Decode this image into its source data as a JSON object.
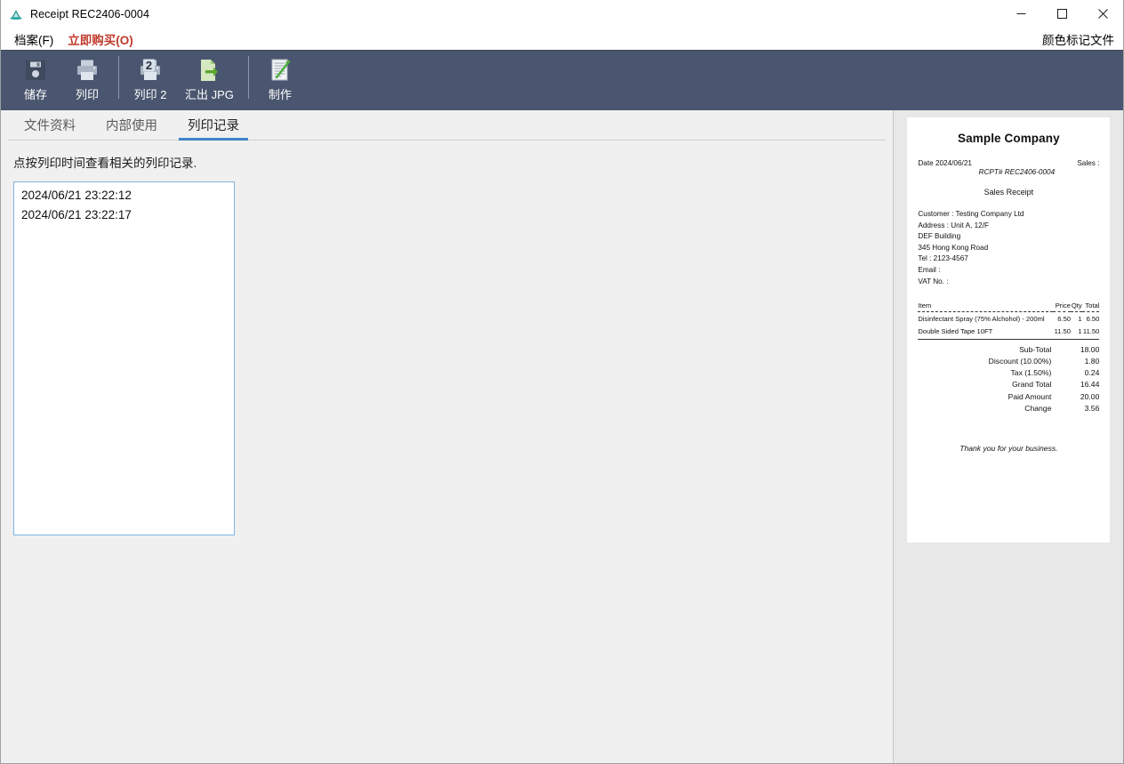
{
  "window": {
    "title": "Receipt REC2406-0004",
    "icon": "app-icon",
    "controls": {
      "minimize": "—",
      "maximize": "☐",
      "close": "✕"
    }
  },
  "menu": {
    "items": [
      {
        "label": "档案(F)",
        "name": "menu-file",
        "accent": false
      },
      {
        "label": "立即购买(O)",
        "name": "menu-buy-now",
        "accent": true
      }
    ],
    "right_label": "颜色标记文件"
  },
  "toolbar": {
    "buttons": [
      {
        "label": "储存",
        "icon": "save-icon",
        "name": "toolbar-save"
      },
      {
        "label": "列印",
        "icon": "print-icon",
        "name": "toolbar-print"
      },
      {
        "label": "列印 2",
        "icon": "print-2-icon",
        "name": "toolbar-print-2"
      },
      {
        "label": "汇出 JPG",
        "icon": "export-jpg-icon",
        "name": "toolbar-export-jpg"
      },
      {
        "label": "制作",
        "icon": "compose-icon",
        "name": "toolbar-compose"
      }
    ]
  },
  "tabs": [
    {
      "label": "文件资料",
      "name": "tab-document-info",
      "active": false
    },
    {
      "label": "内部使用",
      "name": "tab-internal-use",
      "active": false
    },
    {
      "label": "列印记录",
      "name": "tab-print-log",
      "active": true
    }
  ],
  "pane": {
    "hint": "点按列印时间查看相关的列印记录.",
    "print_log": [
      "2024/06/21 23:22:12",
      "2024/06/21 23:22:17"
    ]
  },
  "receipt": {
    "company": "Sample Company",
    "date_label": "Date 2024/06/21",
    "sales_label": "Sales :",
    "rcpt_no": "RCPT# REC2406-0004",
    "doc_title": "Sales Receipt",
    "customer_lines": [
      "Customer : Testing Company Ltd",
      "Address : Unit A, 12/F",
      "DEF Building",
      "345 Hong Kong Road",
      "Tel : 2123-4567",
      "Email :",
      "VAT No. :"
    ],
    "columns": [
      "Item",
      "Price",
      "Qty",
      "Total"
    ],
    "items": [
      {
        "item": "Disinfectant Spray (75% Alchohol) - 200ml",
        "price": "6.50",
        "qty": "1",
        "total": "6.50"
      },
      {
        "item": "Double Sided Tape 10FT",
        "price": "11.50",
        "qty": "1",
        "total": "11.50"
      }
    ],
    "totals": [
      {
        "label": "Sub-Total",
        "value": "18.00"
      },
      {
        "label": "Discount (10.00%)",
        "value": "1.80"
      },
      {
        "label": "Tax (1.50%)",
        "value": "0.24"
      },
      {
        "label": "Grand Total",
        "value": "16.44"
      },
      {
        "label": "Paid Amount",
        "value": "20.00"
      },
      {
        "label": "Change",
        "value": "3.56"
      }
    ],
    "footer": "Thank you for your business."
  },
  "colors": {
    "toolbar_bg": "#4a566f",
    "accent_tab": "#3d85c8",
    "menu_accent": "#c0392b",
    "panel_bg": "#e8e8e8",
    "listbox_border": "#7eb4e2"
  }
}
